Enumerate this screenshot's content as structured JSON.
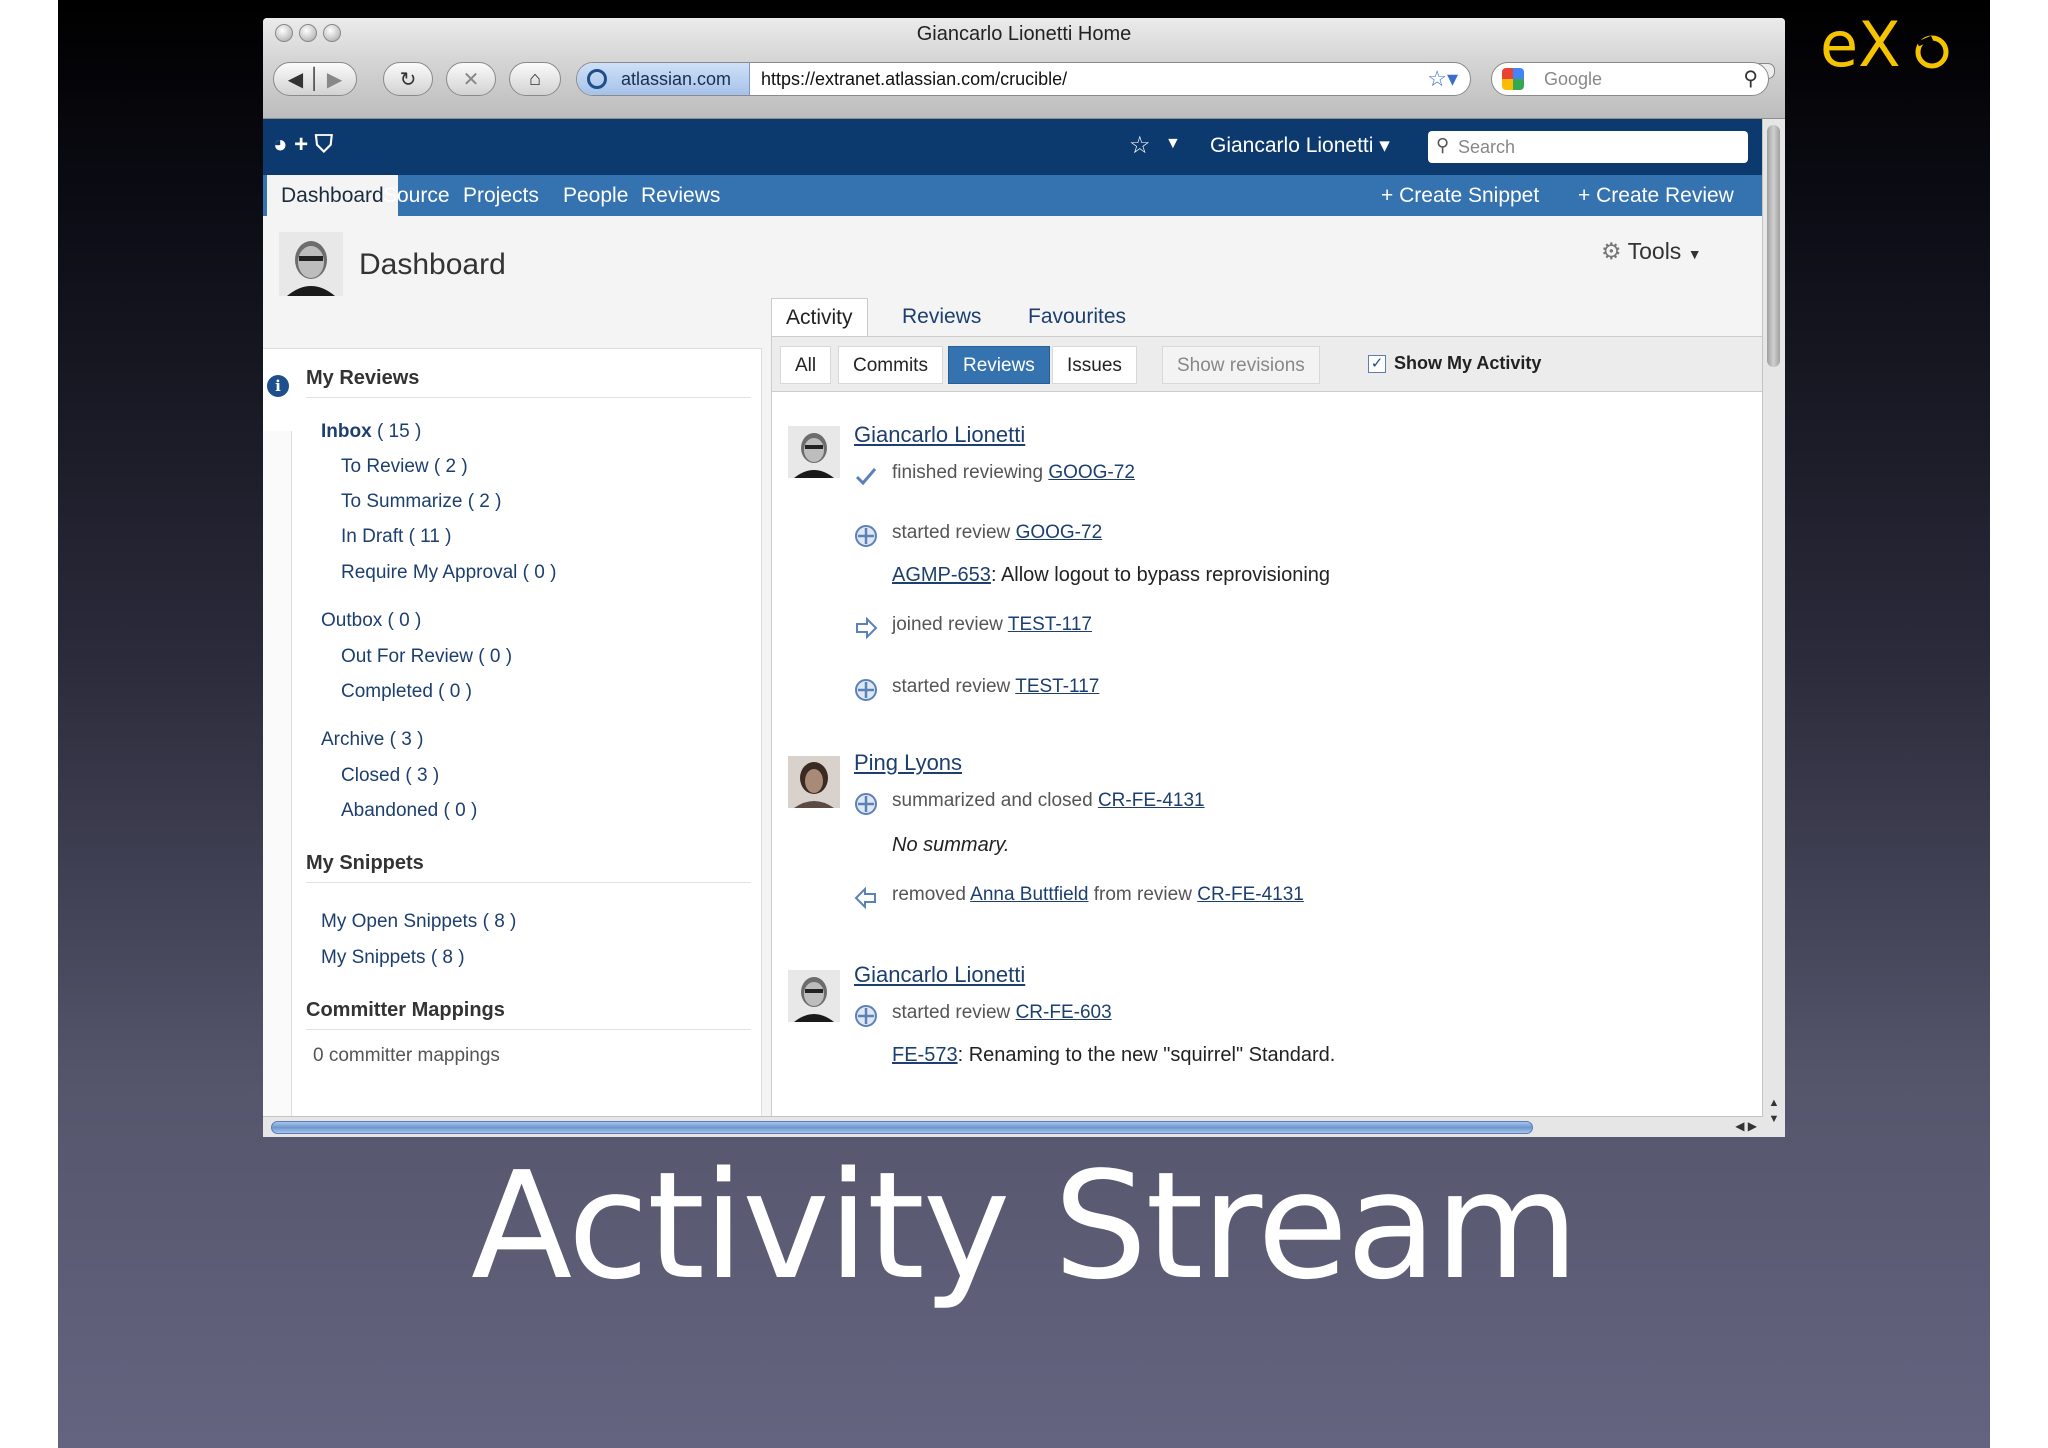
{
  "slide": {
    "title": "Activity Stream",
    "logo_text": "eXo",
    "logo_color": "#f5c400"
  },
  "browser": {
    "window_title": "Giancarlo Lionetti Home",
    "site_badge": "atlassian.com",
    "url": "https://extranet.atlassian.com/crucible/",
    "search_placeholder": "Google",
    "icons": [
      "back-icon",
      "forward-icon",
      "reload-icon",
      "stop-icon",
      "home-icon",
      "bookmark-star-icon",
      "search-icon"
    ]
  },
  "app": {
    "logo": "◕ + ⛉",
    "user": "Giancarlo Lionetti",
    "search_placeholder": "Search",
    "nav_tabs": [
      "Dashboard",
      "Source",
      "Projects",
      "People",
      "Reviews"
    ],
    "actions": [
      "Create Snippet",
      "Create Review"
    ],
    "accent": "#3572b0",
    "header_bg": "#0d3a6e"
  },
  "page": {
    "title": "Dashboard",
    "tools_label": "Tools"
  },
  "sidebar": {
    "my_reviews_title": "My Reviews",
    "inbox": "Inbox",
    "inbox_count": "( 15 )",
    "to_review": "To Review ( 2 )",
    "to_summarize": "To Summarize ( 2 )",
    "in_draft": "In Draft ( 11 )",
    "require_approval": "Require My Approval ( 0 )",
    "outbox": "Outbox ( 0 )",
    "out_for_review": "Out For Review ( 0 )",
    "completed": "Completed ( 0 )",
    "archive": "Archive ( 3 )",
    "closed": "Closed ( 3 )",
    "abandoned": "Abandoned ( 0 )",
    "my_snippets_title": "My Snippets",
    "my_open_snippets": "My Open Snippets ( 8 )",
    "my_snippets": "My Snippets ( 8 )",
    "committer_title": "Committer Mappings",
    "committer_count": "0 committer mappings"
  },
  "stream": {
    "tabs": [
      "Activity",
      "Reviews",
      "Favourites"
    ],
    "filters": [
      "All",
      "Commits",
      "Reviews",
      "Issues",
      "Show revisions"
    ],
    "selected_filter": "Reviews",
    "show_my_activity": "Show My Activity",
    "show_my_activity_checked": true,
    "entries": [
      {
        "user": "Giancarlo Lionetti",
        "items": [
          {
            "text": "finished reviewing",
            "link": "GOOG-72",
            "icon": "checkmark-icon"
          },
          {
            "text": "started review",
            "link": "GOOG-72",
            "icon": "plus-circle-icon"
          },
          {
            "sub_link": "AGMP-653",
            "sub_text": ": Allow logout to bypass reprovisioning"
          },
          {
            "text": "joined review",
            "link": "TEST-117",
            "icon": "arrow-right-icon"
          },
          {
            "text": "started review",
            "link": "TEST-117",
            "icon": "plus-circle-icon"
          }
        ]
      },
      {
        "user": "Ping Lyons",
        "items": [
          {
            "text": "summarized and closed",
            "link": "CR-FE-4131",
            "icon": "plus-circle-icon"
          },
          {
            "sub_text": "No summary."
          },
          {
            "text": "removed",
            "link": "Anna Buttfield",
            "text2": "from review",
            "link2": "CR-FE-4131",
            "icon": "arrow-left-icon"
          }
        ]
      },
      {
        "user": "Giancarlo Lionetti",
        "items": [
          {
            "text": "started review",
            "link": "CR-FE-603",
            "icon": "plus-circle-icon"
          },
          {
            "sub_link": "FE-573",
            "sub_text": ": Renaming to the new \"squirrel\" Standard."
          }
        ]
      }
    ]
  }
}
